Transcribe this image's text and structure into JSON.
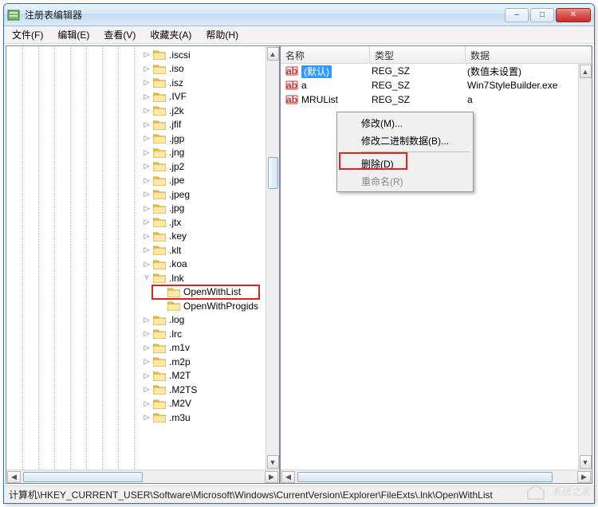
{
  "window": {
    "title": "注册表编辑器"
  },
  "menu": {
    "file": "文件(F)",
    "edit": "编辑(E)",
    "view": "查看(V)",
    "favorites": "收藏夹(A)",
    "help": "帮助(H)"
  },
  "tree": {
    "items": [
      {
        "exp": "▷",
        "label": ".iscsi"
      },
      {
        "exp": "▷",
        "label": ".iso"
      },
      {
        "exp": "▷",
        "label": ".isz"
      },
      {
        "exp": "▷",
        "label": ".IVF"
      },
      {
        "exp": "▷",
        "label": ".j2k"
      },
      {
        "exp": "▷",
        "label": ".jfif"
      },
      {
        "exp": "▷",
        "label": ".jgp"
      },
      {
        "exp": "▷",
        "label": ".jng"
      },
      {
        "exp": "▷",
        "label": ".jp2"
      },
      {
        "exp": "▷",
        "label": ".jpe"
      },
      {
        "exp": "▷",
        "label": ".jpeg"
      },
      {
        "exp": "▷",
        "label": ".jpg"
      },
      {
        "exp": "▷",
        "label": ".jtx"
      },
      {
        "exp": "▷",
        "label": ".key"
      },
      {
        "exp": "▷",
        "label": ".klt"
      },
      {
        "exp": "▷",
        "label": ".koa"
      },
      {
        "exp": "▿",
        "label": ".lnk"
      }
    ],
    "children": [
      {
        "label": "OpenWithList",
        "highlighted": true
      },
      {
        "label": "OpenWithProgids"
      }
    ],
    "items2": [
      {
        "exp": "▷",
        "label": ".log"
      },
      {
        "exp": "▷",
        "label": ".lrc"
      },
      {
        "exp": "▷",
        "label": ".m1v"
      },
      {
        "exp": "▷",
        "label": ".m2p"
      },
      {
        "exp": "▷",
        "label": ".M2T"
      },
      {
        "exp": "▷",
        "label": ".M2TS"
      },
      {
        "exp": "▷",
        "label": ".M2V"
      },
      {
        "exp": "▷",
        "label": ".m3u"
      }
    ]
  },
  "list": {
    "cols": {
      "name": "名称",
      "type": "类型",
      "data": "数据"
    },
    "rows": [
      {
        "name": "(默认)",
        "type": "REG_SZ",
        "data": "(数值未设置)",
        "selected": true
      },
      {
        "name": "a",
        "type": "REG_SZ",
        "data": "Win7StyleBuilder.exe"
      },
      {
        "name": "MRUList",
        "type": "REG_SZ",
        "data": "a"
      }
    ]
  },
  "ctx": {
    "modify": "修改(M)...",
    "modify_bin": "修改二进制数据(B)...",
    "delete": "删除(D)",
    "rename": "重命名(R)"
  },
  "status": {
    "path": "计算机\\HKEY_CURRENT_USER\\Software\\Microsoft\\Windows\\CurrentVersion\\Explorer\\FileExts\\.lnk\\OpenWithList"
  },
  "watermark": {
    "text": "系统之家"
  }
}
